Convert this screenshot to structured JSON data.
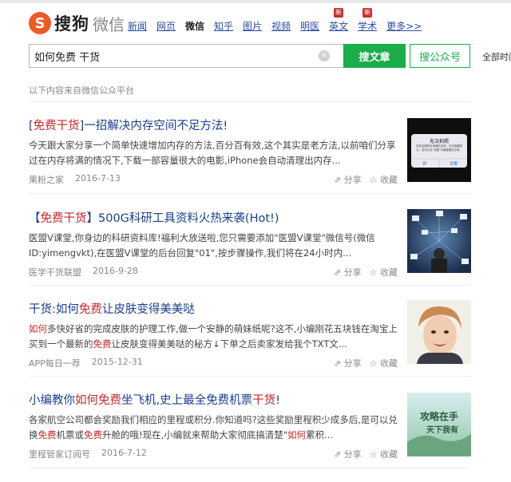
{
  "header": {
    "logo_badge": "S",
    "logo_text": "搜狗",
    "logo_sub": "微信"
  },
  "nav": [
    {
      "label": "新闻",
      "active": false,
      "new": false
    },
    {
      "label": "网页",
      "active": false,
      "new": false
    },
    {
      "label": "微信",
      "active": true,
      "new": false
    },
    {
      "label": "知乎",
      "active": false,
      "new": false
    },
    {
      "label": "图片",
      "active": false,
      "new": false
    },
    {
      "label": "视频",
      "active": false,
      "new": false
    },
    {
      "label": "明医",
      "active": false,
      "new": false
    },
    {
      "label": "英文",
      "active": false,
      "new": true
    },
    {
      "label": "学术",
      "active": false,
      "new": true
    },
    {
      "label": "更多>>",
      "active": false,
      "new": false
    }
  ],
  "new_tag": "新",
  "search": {
    "value": "如何免费 干货",
    "clear": "×"
  },
  "buttons": {
    "article": "搜文章",
    "account": "搜公众号",
    "all_time": "全部时间"
  },
  "source_note": "以下内容来自微信公众平台",
  "actions": {
    "share": "分享",
    "collect": "收藏"
  },
  "results": [
    {
      "title": [
        {
          "t": "[",
          "hl": false
        },
        {
          "t": "免费干货",
          "hl": true
        },
        {
          "t": "]一招解决内存空间不足方法!",
          "hl": false
        }
      ],
      "desc": [
        {
          "t": "今天跟大家分享一个简单快速增加内存的方法,百分百有效,这个其实是老方法,以前咱们分享过在内存将满的情况下,下载一部容量很大的电影,iPhone会自动清理出内存...",
          "hl": false
        }
      ],
      "source": "果粉之家",
      "date": "2016-7-13"
    },
    {
      "title": [
        {
          "t": "【",
          "hl": false
        },
        {
          "t": "免费干货",
          "hl": true
        },
        {
          "t": "】500G科研工具资料火热来袭(Hot!)",
          "hl": false
        }
      ],
      "desc": [
        {
          "t": "医盟V课堂,你身边的科研资料库!福利大放送啦,您只需要添加\"医盟V课堂\"微信号(微信ID:yimengvkt),在医盟V课堂的后台回复\"01\",按步骤操作,我们将在24小时内...",
          "hl": false
        }
      ],
      "source": "医学干货联盟",
      "date": "2016-9-28"
    },
    {
      "title": [
        {
          "t": "干货:如何",
          "hl": false
        },
        {
          "t": "免费",
          "hl": true
        },
        {
          "t": "让皮肤变得美美哒",
          "hl": false
        }
      ],
      "desc": [
        {
          "t": "如何",
          "hl": true
        },
        {
          "t": "多快好省的完成皮肤的护理工作,做一个安静的萌妹纸呢?这不,小编刚花五块钱在淘宝上买到一个最新的",
          "hl": false
        },
        {
          "t": "免费",
          "hl": true
        },
        {
          "t": "让皮肤变得美美哒的秘方↓下单之后卖家发给我个TXT文...",
          "hl": false
        }
      ],
      "source": "APP每日一荐",
      "date": "2015-12-31"
    },
    {
      "title": [
        {
          "t": "小编教你",
          "hl": false
        },
        {
          "t": "如何免费",
          "hl": true
        },
        {
          "t": "坐飞机,史上最全免费机票",
          "hl": false
        },
        {
          "t": "干货",
          "hl": true
        },
        {
          "t": "!",
          "hl": false
        }
      ],
      "desc": [
        {
          "t": "各家航空公司都会奖励我们相应的里程或积分.你知道吗?这些奖励里程积少成多后,是可以兑换",
          "hl": false
        },
        {
          "t": "免费",
          "hl": true
        },
        {
          "t": "机票或",
          "hl": false
        },
        {
          "t": "免费",
          "hl": true
        },
        {
          "t": "升舱的哦!现在,小编就来帮助大家彻底搞清楚\"",
          "hl": false
        },
        {
          "t": "如何",
          "hl": true
        },
        {
          "t": "累积...",
          "hl": false
        }
      ],
      "source": "里程管家订阅号",
      "date": "2016-7-12"
    }
  ],
  "thumb_texts": {
    "alert_title": "无法拍照",
    "alert_body": "没有足够的可用储存空间，无法拍摄照片。您可以在\"设置\"中管理储存空间。",
    "alert_ok": "好",
    "alert_settings": "设置",
    "poster_line1": "攻略在手",
    "poster_line2": "天下我有"
  },
  "colors": {
    "brand_orange": "#ef5a24",
    "green": "#1aad4a",
    "link_blue": "#1a3f8f",
    "highlight_red": "#c62828"
  }
}
